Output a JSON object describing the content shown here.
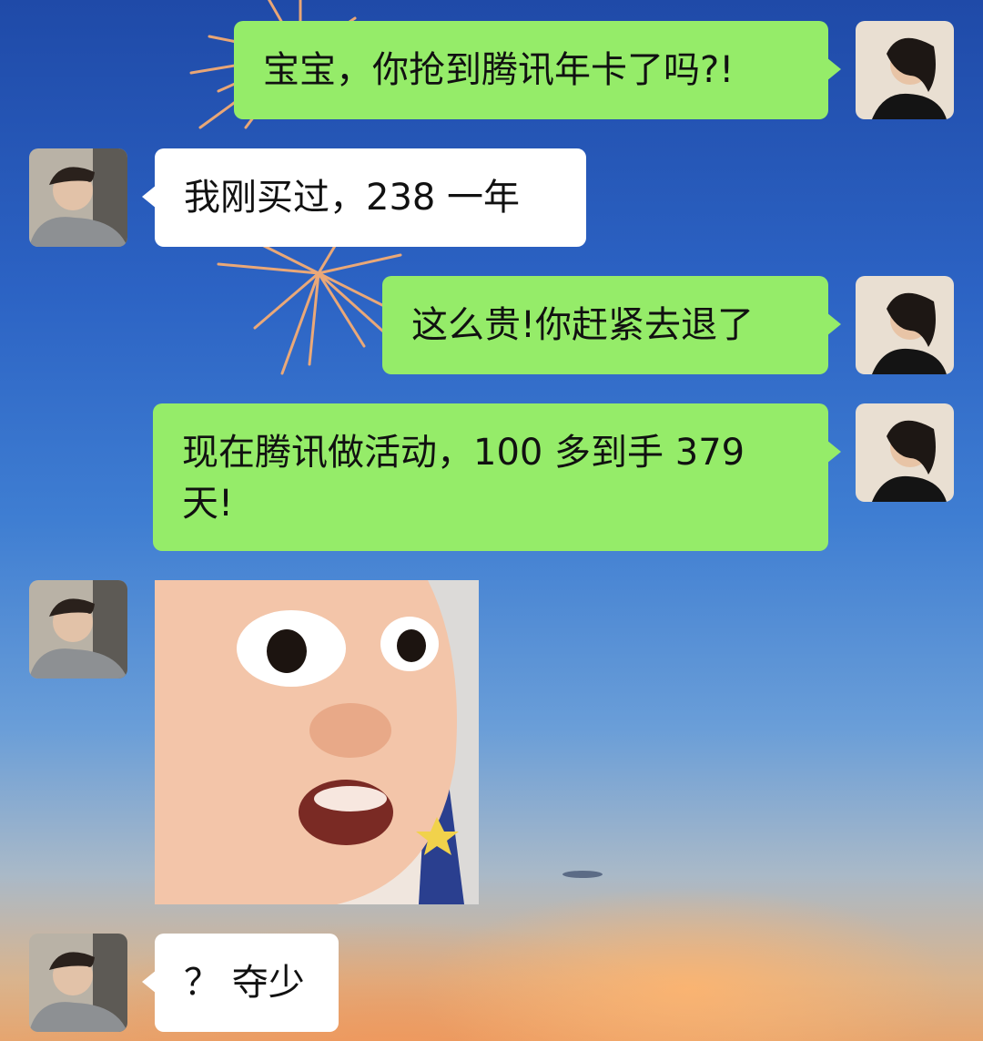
{
  "colors": {
    "sent_bubble": "#95ec69",
    "received_bubble": "#ffffff",
    "sky_top": "#1f4aa8",
    "sky_sunset": "#e6a56f"
  },
  "messages": [
    {
      "side": "sent",
      "type": "text",
      "avatar": "woman-avatar",
      "text": "宝宝，你抢到腾讯年卡了吗?!"
    },
    {
      "side": "received",
      "type": "text",
      "avatar": "boy-avatar",
      "text": "我刚买过，238 一年"
    },
    {
      "side": "sent",
      "type": "text",
      "avatar": "woman-avatar",
      "text": "这么贵!你赶紧去退了"
    },
    {
      "side": "sent",
      "type": "text",
      "avatar": "woman-avatar",
      "text": "现在腾讯做活动，100 多到手 379 天!"
    },
    {
      "side": "received",
      "type": "sticker",
      "avatar": "boy-avatar",
      "sticker": "surprised-baby-sticker"
    },
    {
      "side": "received",
      "type": "text",
      "avatar": "boy-avatar",
      "text": "？ 夺少"
    }
  ]
}
